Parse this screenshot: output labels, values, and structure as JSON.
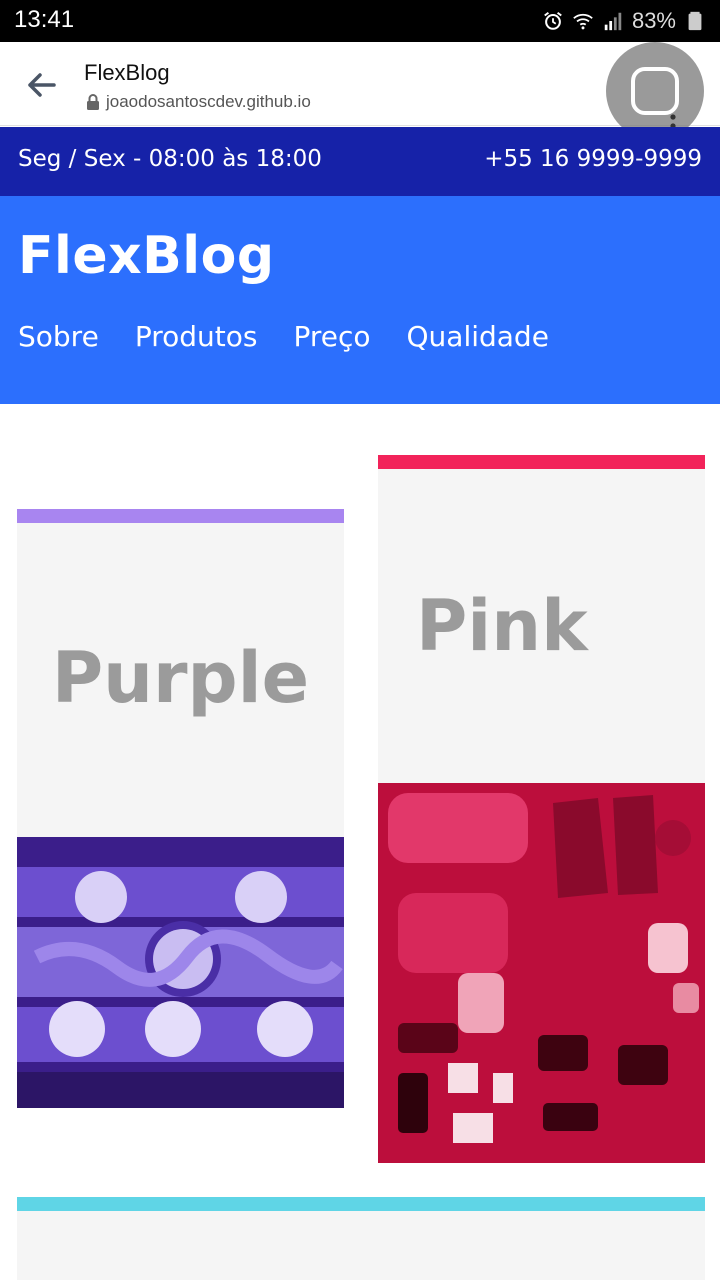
{
  "status_bar": {
    "time": "13:41",
    "battery": "83%",
    "icons": [
      "alarm-icon",
      "wifi-icon",
      "signal-icon",
      "battery-icon"
    ]
  },
  "browser": {
    "title": "FlexBlog",
    "url": "joaodosantoscdev.github.io"
  },
  "topbar": {
    "hours": "Seg / Sex - 08:00 às 18:00",
    "phone": "+55 16 9999-9999",
    "background": "#1622a8"
  },
  "header": {
    "logo": "FlexBlog",
    "background": "#2c6ffd",
    "nav": [
      {
        "label": "Sobre"
      },
      {
        "label": "Produtos"
      },
      {
        "label": "Preço"
      },
      {
        "label": "Qualidade"
      }
    ]
  },
  "cards": [
    {
      "label": "Purple",
      "accent": "#a885f0",
      "image": "dinner-table-photo-purple"
    },
    {
      "label": "Pink",
      "accent": "#f2235a",
      "image": "camping-gear-photo-pink"
    },
    {
      "label": "",
      "accent": "#5fd5e6"
    }
  ]
}
